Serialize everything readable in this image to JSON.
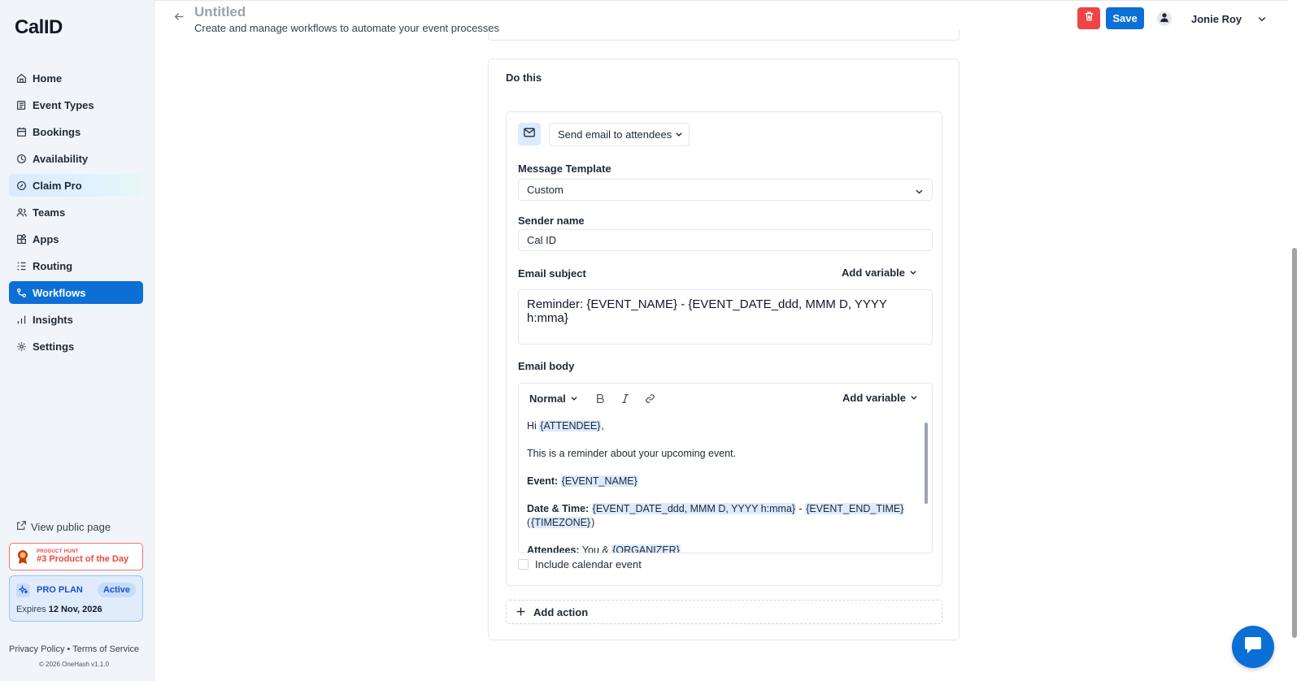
{
  "app": {
    "logo": "CalID"
  },
  "sidebar": {
    "items": [
      {
        "label": "Home",
        "icon": "home-icon"
      },
      {
        "label": "Event Types",
        "icon": "event-types-icon"
      },
      {
        "label": "Bookings",
        "icon": "calendar-icon"
      },
      {
        "label": "Availability",
        "icon": "clock-icon"
      },
      {
        "label": "Claim Pro",
        "icon": "badge-icon"
      },
      {
        "label": "Teams",
        "icon": "users-icon"
      },
      {
        "label": "Apps",
        "icon": "grid-icon"
      },
      {
        "label": "Routing",
        "icon": "routing-icon"
      },
      {
        "label": "Workflows",
        "icon": "workflow-icon"
      },
      {
        "label": "Insights",
        "icon": "bar-chart-icon"
      },
      {
        "label": "Settings",
        "icon": "gear-icon"
      }
    ],
    "active": "Workflows",
    "view_public": "View public page",
    "product_hunt": {
      "small": "PRODUCT HUNT",
      "big": "#3 Product of the Day"
    },
    "pro_plan": {
      "label": "PRO PLAN",
      "status": "Active",
      "expires_label": "Expires",
      "expires_date": "12 Nov, 2026"
    },
    "footer": {
      "privacy": "Privacy Policy",
      "separator": "•",
      "terms": "Terms of Service",
      "copyright": "© 2026 OneHash v1.1.0"
    }
  },
  "header": {
    "title": "Untitled",
    "subtitle": "Create and manage workflows to automate your event processes",
    "save_label": "Save",
    "user_name": "Jonie Roy"
  },
  "action_card": {
    "title": "Do this",
    "action_select": "Send email to attendees",
    "message_template": {
      "label": "Message Template",
      "value": "Custom"
    },
    "sender_name": {
      "label": "Sender name",
      "value": "Cal ID"
    },
    "email_subject": {
      "label": "Email subject",
      "add_variable": "Add variable",
      "value": "Reminder: {EVENT_NAME} - {EVENT_DATE_ddd, MMM D, YYYY h:mma}"
    },
    "email_body": {
      "label": "Email body",
      "format": "Normal",
      "add_variable": "Add variable",
      "greeting_prefix": "Hi ",
      "greeting_var": "{ATTENDEE}",
      "greeting_suffix": ",",
      "intro": "This is a reminder about your upcoming event.",
      "event_label": "Event:",
      "event_var": "{EVENT_NAME}",
      "datetime_label": "Date & Time:",
      "datetime_var": "{EVENT_DATE_ddd, MMM D, YYYY h:mma}",
      "datetime_sep": " - ",
      "end_var": "{EVENT_END_TIME}",
      "tz_open": "(",
      "tz_var": "{TIMEZONE}",
      "tz_close": ")",
      "attendees_label": "Attendees:",
      "attendees_text": " You & ",
      "attendees_var": "{ORGANIZER}"
    },
    "include_calendar": "Include calendar event",
    "add_action": "Add action"
  },
  "colors": {
    "primary": "#0b6fd6",
    "danger": "#ef4444",
    "variable_highlight": "#dbeafe"
  }
}
